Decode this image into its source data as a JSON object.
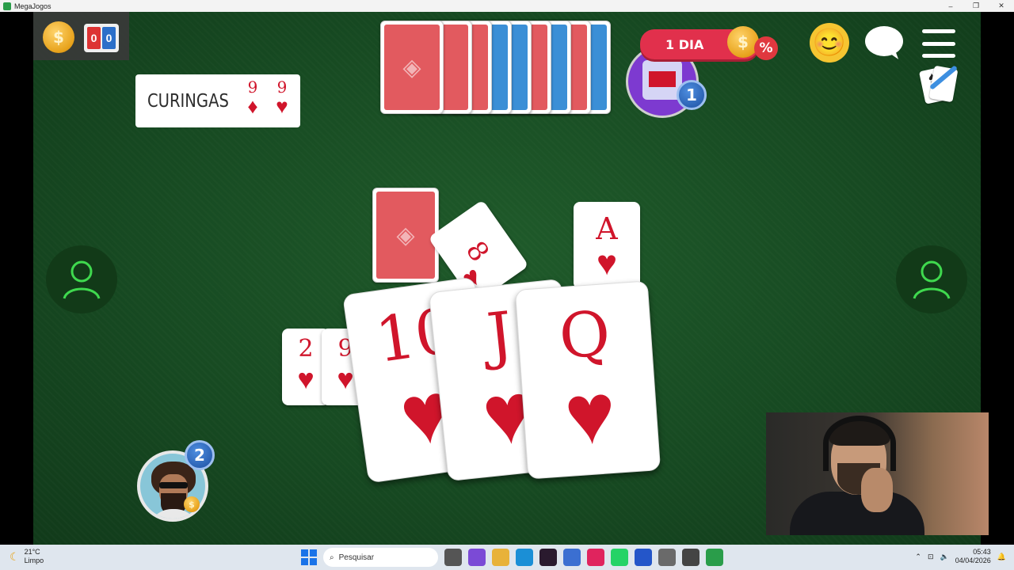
{
  "window": {
    "title": "MegaJogos",
    "minimize": "–",
    "maximize": "❐",
    "close": "✕"
  },
  "hud": {
    "coin_symbol": "$",
    "scoreboard_left": "0",
    "scoreboard_right": "0",
    "promo_label": "1 DIA",
    "promo_percent": "%",
    "emoji": "😊",
    "opponent_badge": "1",
    "self_badge": "2"
  },
  "wildcards": {
    "label": "CURINGAS",
    "cards": [
      {
        "rank": "9",
        "suit": "♦"
      },
      {
        "rank": "9",
        "suit": "♥"
      }
    ]
  },
  "opponent_stack": {
    "backs": [
      "red",
      "red",
      "red",
      "blue",
      "blue",
      "red",
      "blue",
      "red",
      "blue"
    ]
  },
  "table": {
    "pile_top": {
      "rank": "8",
      "suit": "♥"
    },
    "discard": {
      "rank": "A",
      "suit": "♥"
    },
    "small_sequence": [
      {
        "rank": "2",
        "suit": "♥"
      },
      {
        "rank": "9",
        "suit": "♥"
      }
    ],
    "big_sequence": [
      {
        "rank": "10",
        "suit": "♥"
      },
      {
        "rank": "J",
        "suit": "♥"
      },
      {
        "rank": "Q",
        "suit": "♥"
      }
    ]
  },
  "taskbar": {
    "temperature": "21°C",
    "condition": "Limpo",
    "search_placeholder": "Pesquisar",
    "time": "05:43",
    "date": "04/04/2026"
  }
}
